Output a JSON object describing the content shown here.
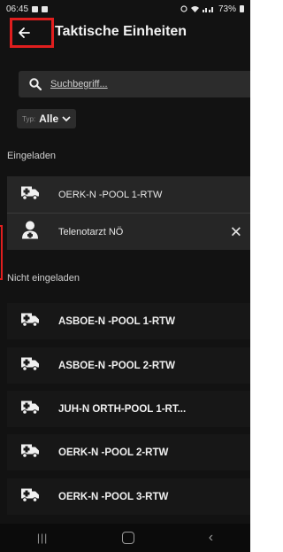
{
  "status_bar": {
    "time": "06:45",
    "battery": "73%"
  },
  "app_bar": {
    "title": "Taktische Einheiten"
  },
  "search": {
    "placeholder": "Suchbegriff..."
  },
  "filter": {
    "prefix": "Typ:",
    "value": "Alle"
  },
  "sections": {
    "invited": "Eingeladen",
    "not_invited": "Nicht eingeladen"
  },
  "invited_units": [
    {
      "name": "OERK-N -POOL 1-RTW",
      "icon": "ambulance-icon"
    },
    {
      "name": "Telenotarzt NÖ",
      "icon": "doctor-icon",
      "removable": true
    }
  ],
  "not_invited_units": [
    {
      "name": "ASBOE-N -POOL 1-RTW",
      "icon": "ambulance-icon"
    },
    {
      "name": "ASBOE-N -POOL 2-RTW",
      "icon": "ambulance-icon"
    },
    {
      "name": "JUH-N ORTH-POOL 1-RT...",
      "icon": "ambulance-icon"
    },
    {
      "name": "OERK-N -POOL 2-RTW",
      "icon": "ambulance-icon"
    },
    {
      "name": "OERK-N -POOL 3-RTW",
      "icon": "ambulance-icon"
    }
  ],
  "colors": {
    "background": "#121212",
    "surface": "#2c2c2c",
    "highlight_outline": "#e01e1e"
  }
}
